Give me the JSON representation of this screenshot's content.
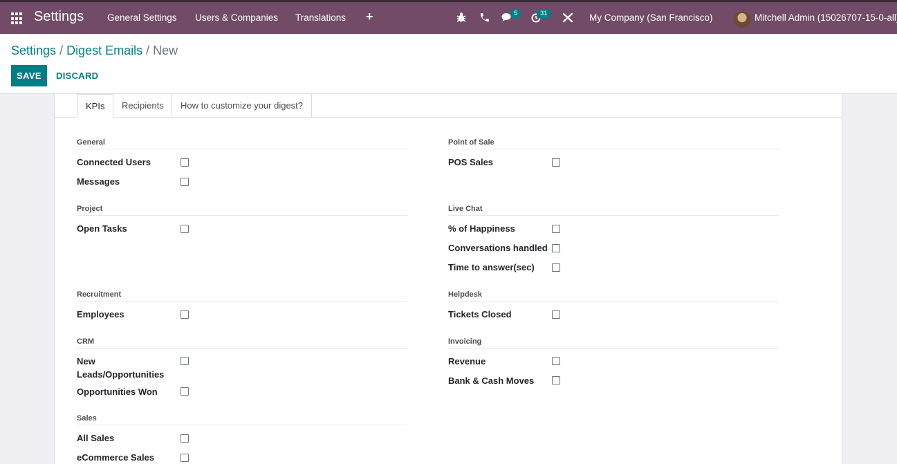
{
  "navbar": {
    "app_title": "Settings",
    "menu": [
      "General Settings",
      "Users & Companies",
      "Translations"
    ],
    "plus_icon": "+",
    "messages_badge": "5",
    "activity_badge": "31",
    "company": "My Company (San Francisco)",
    "user": "Mitchell Admin (15026707-15-0-all)"
  },
  "breadcrumb": {
    "root": "Settings",
    "parent": "Digest Emails",
    "current": "New",
    "sep": "/"
  },
  "buttons": {
    "save": "SAVE",
    "discard": "DISCARD"
  },
  "tabs": [
    "KPIs",
    "Recipients",
    "How to customize your digest?"
  ],
  "groups": {
    "general": {
      "title": "General",
      "fields": [
        "Connected Users",
        "Messages"
      ]
    },
    "project": {
      "title": "Project",
      "fields": [
        "Open Tasks"
      ]
    },
    "recruitment": {
      "title": "Recruitment",
      "fields": [
        "Employees"
      ]
    },
    "crm": {
      "title": "CRM",
      "fields": [
        "New Leads/Opportunities",
        "Opportunities Won"
      ]
    },
    "sales": {
      "title": "Sales",
      "fields": [
        "All Sales",
        "eCommerce Sales"
      ]
    },
    "pos": {
      "title": "Point of Sale",
      "fields": [
        "POS Sales"
      ]
    },
    "livechat": {
      "title": "Live Chat",
      "fields": [
        "% of Happiness",
        "Conversations handled",
        "Time to answer(sec)"
      ]
    },
    "helpdesk": {
      "title": "Helpdesk",
      "fields": [
        "Tickets Closed"
      ]
    },
    "invoicing": {
      "title": "Invoicing",
      "fields": [
        "Revenue",
        "Bank & Cash Moves"
      ]
    }
  }
}
